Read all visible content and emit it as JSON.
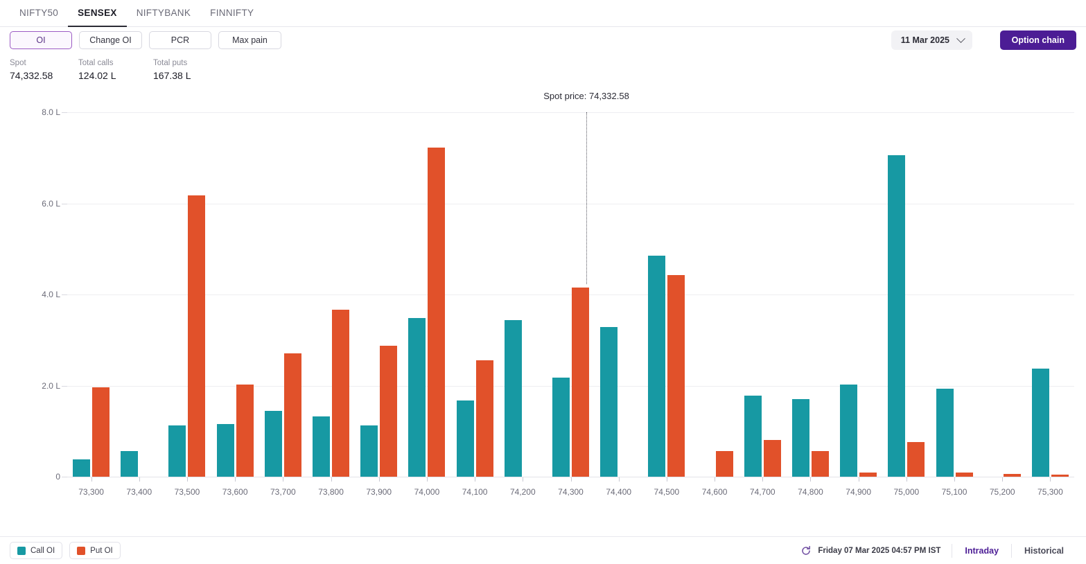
{
  "tabs": [
    {
      "label": "NIFTY50",
      "active": false
    },
    {
      "label": "SENSEX",
      "active": true
    },
    {
      "label": "NIFTYBANK",
      "active": false
    },
    {
      "label": "FINNIFTY",
      "active": false
    }
  ],
  "toolbar": {
    "oi_label": "OI",
    "change_oi_label": "Change OI",
    "pcr_label": "PCR",
    "max_pain_label": "Max pain",
    "expiry_value": "11 Mar 2025",
    "option_chain_label": "Option chain",
    "chevron_icon": "chevron-down-icon"
  },
  "stats": [
    {
      "label": "Spot",
      "value": "74,332.58"
    },
    {
      "label": "Total calls",
      "value": "124.02 L"
    },
    {
      "label": "Total puts",
      "value": "167.38 L"
    }
  ],
  "annotation": {
    "spot_price_label": "Spot price: 74,332.58",
    "spot_price_value": 74332.58
  },
  "legend": [
    {
      "label": "Call OI",
      "color": "#1799a3"
    },
    {
      "label": "Put OI",
      "color": "#e1512a"
    }
  ],
  "footer": {
    "refresh_icon": "refresh-icon",
    "timestamp": "Friday 07 Mar 2025 04:57 PM IST",
    "intraday_label": "Intraday",
    "historical_label": "Historical"
  },
  "colors": {
    "call": "#1799a3",
    "put": "#e1512a",
    "accent": "#4c1d95",
    "accent_soft": "#9b5bc4"
  },
  "chart_data": {
    "type": "bar",
    "title": "",
    "xlabel": "",
    "ylabel": "",
    "unit": "L",
    "grid": true,
    "legend_position": "bottom-left",
    "ylim": [
      0,
      8
    ],
    "yticks": [
      0,
      2,
      4,
      6,
      8
    ],
    "ytick_labels": [
      "0",
      "2.0 L",
      "4.0 L",
      "6.0 L",
      "8.0 L"
    ],
    "categories": [
      "73,300",
      "73,400",
      "73,500",
      "73,600",
      "73,700",
      "73,800",
      "73,900",
      "74,000",
      "74,100",
      "74,200",
      "74,300",
      "74,400",
      "74,500",
      "74,600",
      "74,700",
      "74,800",
      "74,900",
      "75,000",
      "75,100",
      "75,200",
      "75,300"
    ],
    "series": [
      {
        "name": "Call OI",
        "color": "#1799a3",
        "values": [
          0.38,
          0.56,
          1.12,
          1.15,
          1.45,
          1.33,
          1.12,
          3.48,
          1.68,
          3.44,
          2.17,
          3.29,
          4.85,
          0.0,
          1.78,
          1.7,
          2.03,
          7.05,
          1.93,
          0.0,
          2.38
        ]
      },
      {
        "name": "Put OI",
        "color": "#e1512a",
        "values": [
          1.96,
          0.0,
          6.18,
          2.03,
          2.7,
          3.66,
          2.87,
          7.22,
          2.55,
          0.0,
          4.15,
          0.0,
          4.42,
          0.57,
          0.8,
          0.57,
          0.09,
          0.76,
          0.09,
          0.06,
          0.04
        ]
      }
    ],
    "spot_line": {
      "x": "74,332.58",
      "label": "Spot price: 74,332.58"
    }
  }
}
